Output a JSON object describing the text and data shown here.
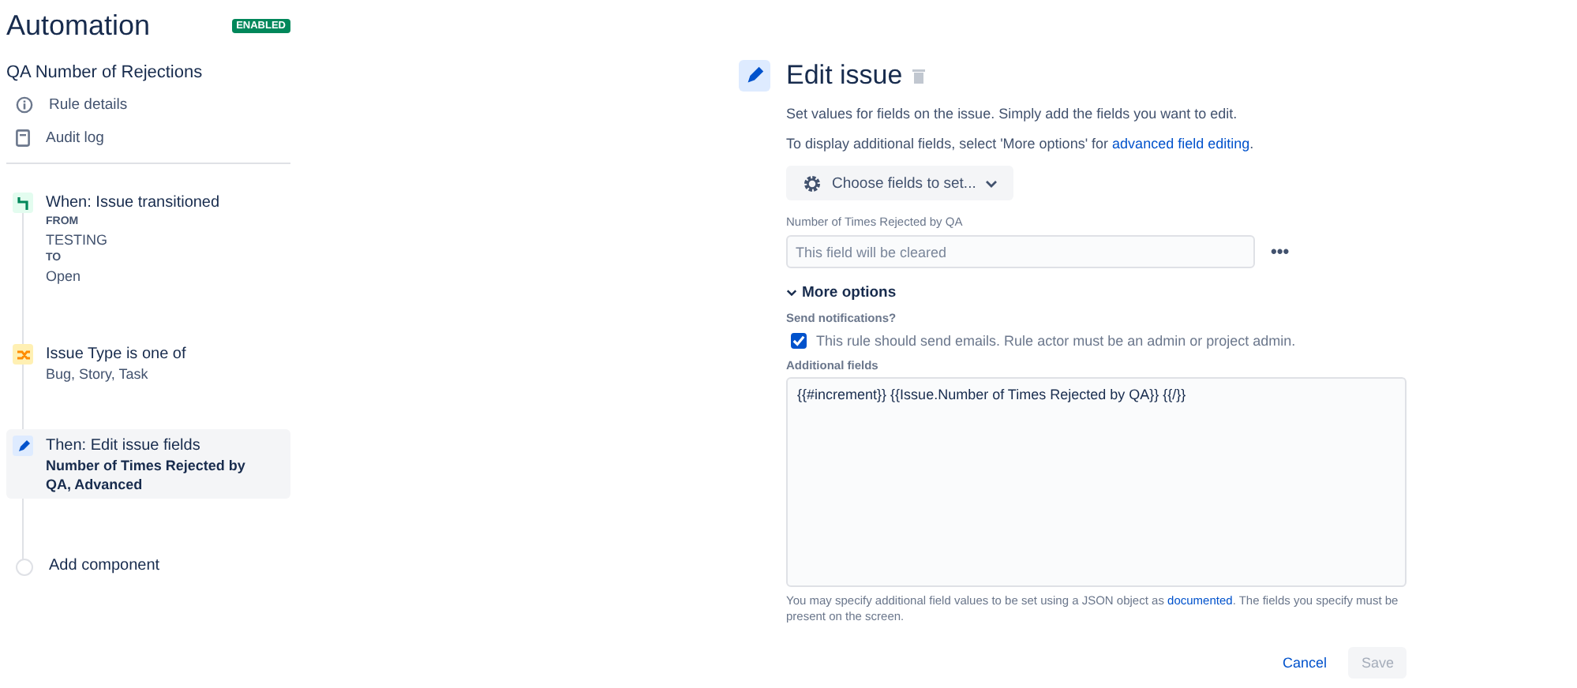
{
  "header": {
    "title": "Automation",
    "status_badge": "ENABLED"
  },
  "rule": {
    "name": "QA Number of Rejections",
    "links": [
      {
        "kind": "info",
        "label": "Rule details"
      },
      {
        "kind": "log",
        "label": "Audit log"
      }
    ]
  },
  "steps": [
    {
      "kind": "trigger",
      "title": "When: Issue transitioned",
      "selected": false,
      "details": [
        {
          "kind": "label",
          "text": "FROM"
        },
        {
          "kind": "value",
          "text": "TESTING"
        },
        {
          "kind": "label",
          "text": "TO"
        },
        {
          "kind": "value",
          "text": "Open"
        }
      ]
    },
    {
      "kind": "condition",
      "title": "Issue Type is one of",
      "selected": false,
      "details": [
        {
          "kind": "value",
          "text": "Bug, Story, Task"
        }
      ]
    },
    {
      "kind": "action",
      "title": "Then: Edit issue fields",
      "selected": true,
      "details": [
        {
          "kind": "strong",
          "text": "Number of Times Rejected by QA, Advanced"
        }
      ]
    },
    {
      "kind": "add",
      "title": "Add component",
      "selected": false
    }
  ],
  "editor": {
    "title": "Edit issue",
    "intro": "Set values for fields on the issue. Simply add the fields you want to edit.",
    "hint": "To display additional fields, select 'More options' for ",
    "hint_link": "advanced field editing",
    "hint_end": ".",
    "choose_button": "Choose fields to set...",
    "field": {
      "label": "Number of Times Rejected by QA",
      "placeholder": "This field will be cleared",
      "menu": "•••"
    },
    "more_options": {
      "label": "More options",
      "expanded": true
    },
    "notifications": {
      "label": "Send notifications?",
      "text": "This rule should send emails. Rule actor must be an admin or project admin.",
      "checked": true
    },
    "additional": {
      "label": "Additional fields",
      "value": "{{#increment}} {{Issue.Number of Times Rejected by QA}} {{/}}"
    },
    "help": "You may specify additional field values to be set using a JSON object as ",
    "help_link": "documented",
    "help_end": ". The fields you specify must be present on the screen.",
    "buttons": [
      {
        "kind": "link",
        "label": "Cancel",
        "disabled": false
      },
      {
        "kind": "primary",
        "label": "Save",
        "disabled": true
      }
    ]
  }
}
